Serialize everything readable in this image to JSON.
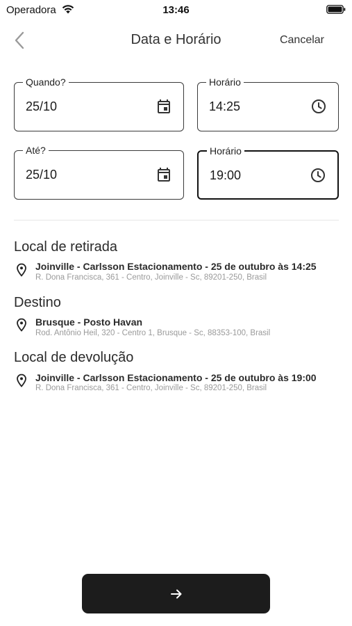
{
  "status_bar": {
    "carrier": "Operadora",
    "time": "13:46"
  },
  "nav": {
    "title": "Data e Horário",
    "cancel_label": "Cancelar",
    "back_icon": "chevron-left-icon"
  },
  "pickup": {
    "date_label": "Quando?",
    "date_value": "25/10",
    "time_label": "Horário",
    "time_value": "14:25"
  },
  "dropoff": {
    "date_label": "Até?",
    "date_value": "25/10",
    "time_label": "Horário",
    "time_value": "19:00"
  },
  "locations": {
    "pickup": {
      "title": "Local de retirada",
      "name": "Joinville - Carlsson Estacionamento - 25 de outubro às 14:25",
      "address": "R. Dona Francisca, 361 - Centro, Joinville - Sc, 89201-250, Brasil"
    },
    "destination": {
      "title": "Destino",
      "name": "Brusque - Posto Havan",
      "address": "Rod. Antônio Heil, 320 - Centro 1, Brusque - Sc, 88353-100, Brasil"
    },
    "return": {
      "title": "Local de devolução",
      "name": "Joinville - Carlsson Estacionamento - 25 de outubro às 19:00",
      "address": "R. Dona Francisca, 361 - Centro, Joinville - Sc, 89201-250, Brasil"
    }
  },
  "next_button": {
    "icon": "arrow-right-icon",
    "color": "#1c1c1c"
  }
}
